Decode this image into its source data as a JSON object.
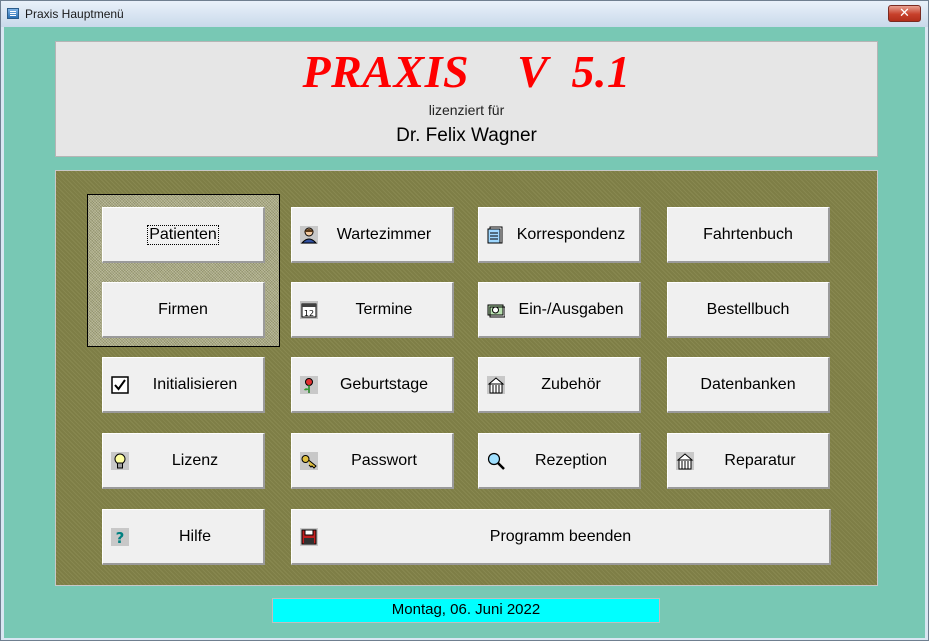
{
  "window": {
    "title": "Praxis Hauptmenü",
    "close_symbol": "✕"
  },
  "header": {
    "app_title": "PRAXIS    V  5.1",
    "licensed_label": "lizenziert für",
    "licensee": "Dr. Felix Wagner"
  },
  "buttons": {
    "patienten": "Patienten",
    "wartezimmer": "Wartezimmer",
    "korrespondenz": "Korrespondenz",
    "fahrtenbuch": "Fahrtenbuch",
    "firmen": "Firmen",
    "termine": "Termine",
    "ein_ausgaben": "Ein-/Ausgaben",
    "bestellbuch": "Bestellbuch",
    "initialisieren": "Initialisieren",
    "geburtstage": "Geburtstage",
    "zubehoer": "Zubehör",
    "datenbanken": "Datenbanken",
    "lizenz": "Lizenz",
    "passwort": "Passwort",
    "rezeption": "Rezeption",
    "reparatur": "Reparatur",
    "hilfe": "Hilfe",
    "programm_beenden": "Programm beenden"
  },
  "icons": {
    "wartezimmer": "person-icon",
    "korrespondenz": "document-icon",
    "termine": "calendar-icon",
    "ein_ausgaben": "money-icon",
    "initialisieren": "checkbox-icon",
    "geburtstage": "flower-icon",
    "zubehoer": "building-icon",
    "lizenz": "lightbulb-icon",
    "passwort": "key-icon",
    "rezeption": "magnifier-icon",
    "reparatur": "building-icon",
    "hilfe": "question-icon",
    "programm_beenden": "floppy-disk-icon"
  },
  "status": {
    "date": "Montag, 06. Juni 2022"
  },
  "colors": {
    "title_red": "#ff0000",
    "background_teal": "#78c8b4",
    "panel_olive": "#7e7e46",
    "date_cyan": "#00ffff"
  }
}
